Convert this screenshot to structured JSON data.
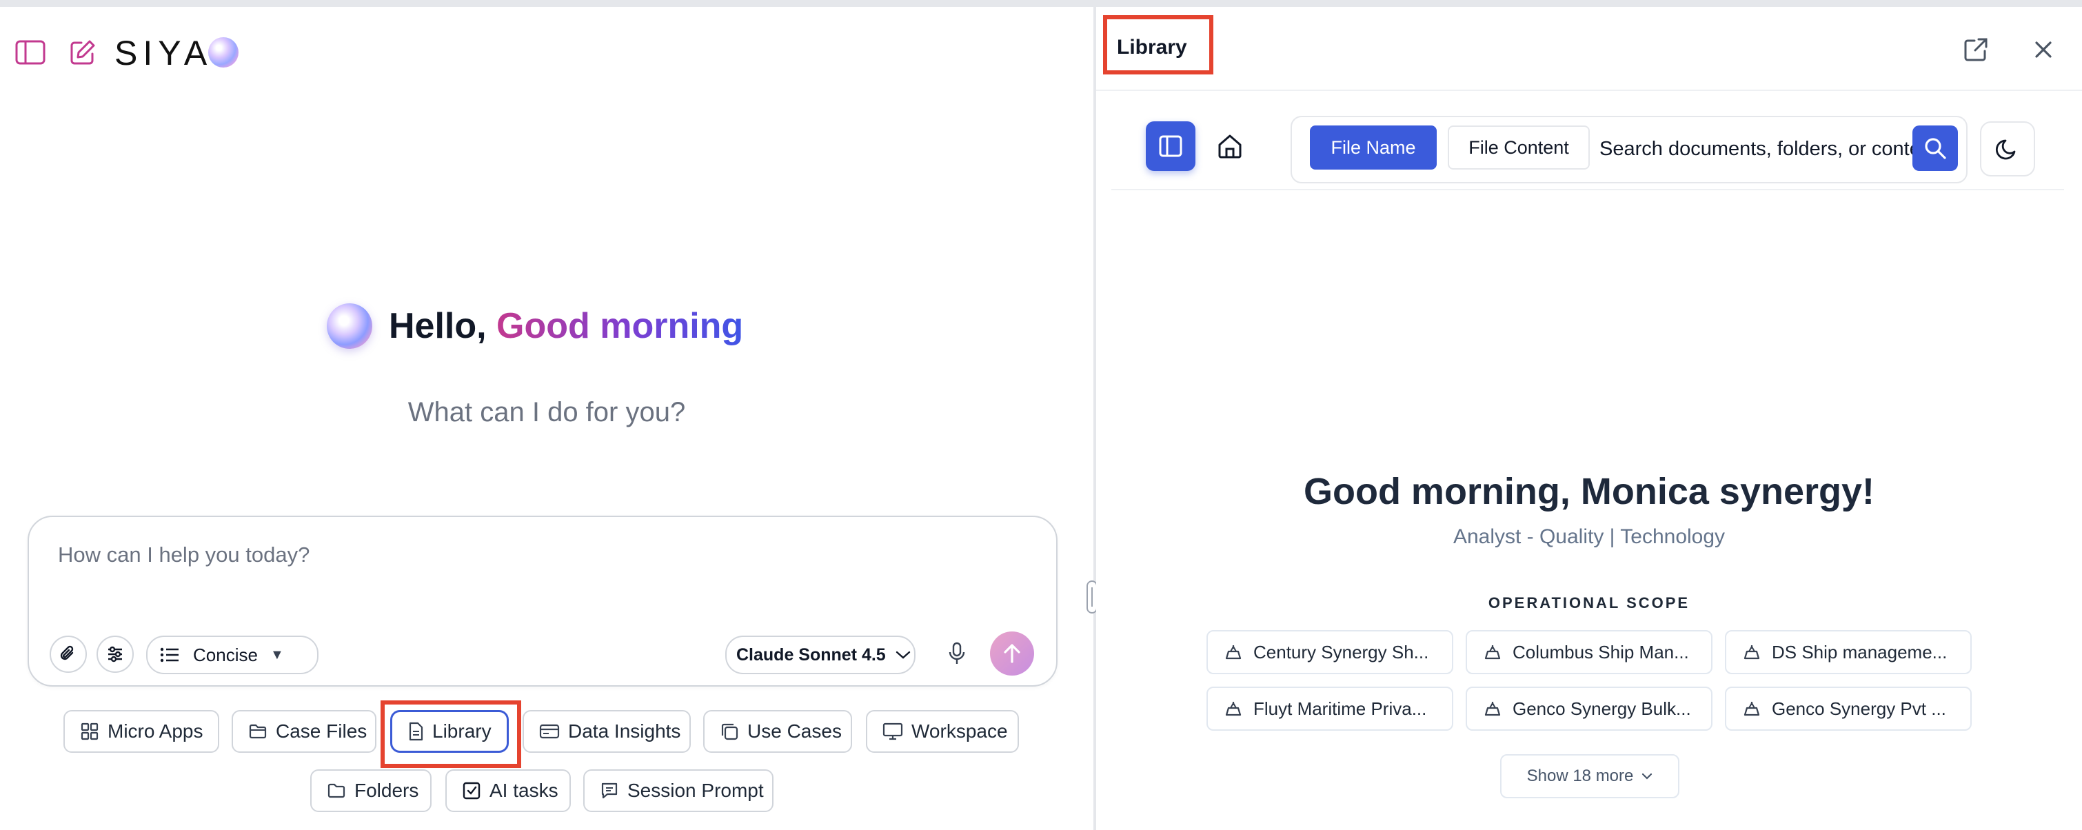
{
  "left": {
    "logo_text": "SIYA",
    "greeting_prefix": "Hello, ",
    "greeting_highlight": "Good morning",
    "subgreeting": "What can I do for you?",
    "composer": {
      "placeholder": "How can I help you today?",
      "mode_label": "Concise",
      "model_label": "Claude Sonnet 4.5"
    },
    "chips_row1": [
      {
        "label": "Micro Apps",
        "icon": "grid-icon"
      },
      {
        "label": "Case Files",
        "icon": "folder-icon"
      },
      {
        "label": "Library",
        "icon": "document-icon"
      },
      {
        "label": "Data Insights",
        "icon": "card-icon"
      },
      {
        "label": "Use Cases",
        "icon": "copy-icon"
      },
      {
        "label": "Workspace",
        "icon": "monitor-icon"
      }
    ],
    "chips_row2": [
      {
        "label": "Folders",
        "icon": "folder-icon"
      },
      {
        "label": "AI tasks",
        "icon": "checkbox-icon"
      },
      {
        "label": "Session Prompt",
        "icon": "message-icon"
      }
    ]
  },
  "right": {
    "panel_title": "Library",
    "search": {
      "file_name_label": "File Name",
      "file_content_label": "File Content",
      "placeholder": "Search documents, folders, or content"
    },
    "welcome": "Good morning, Monica synergy!",
    "role": "Analyst - Quality | Technology",
    "scope_heading": "OPERATIONAL SCOPE",
    "scope_items": [
      "Century Synergy Sh...",
      "Columbus Ship Man...",
      "DS Ship manageme...",
      "Fluyt Maritime Priva...",
      "Genco Synergy Bulk...",
      "Genco Synergy Pvt ..."
    ],
    "show_more": "Show 18 more"
  },
  "colors": {
    "accent": "#3b5bdb",
    "highlight_box": "#e5432f",
    "brand_pink": "#c2398f",
    "brand_blue": "#3f55e6"
  }
}
